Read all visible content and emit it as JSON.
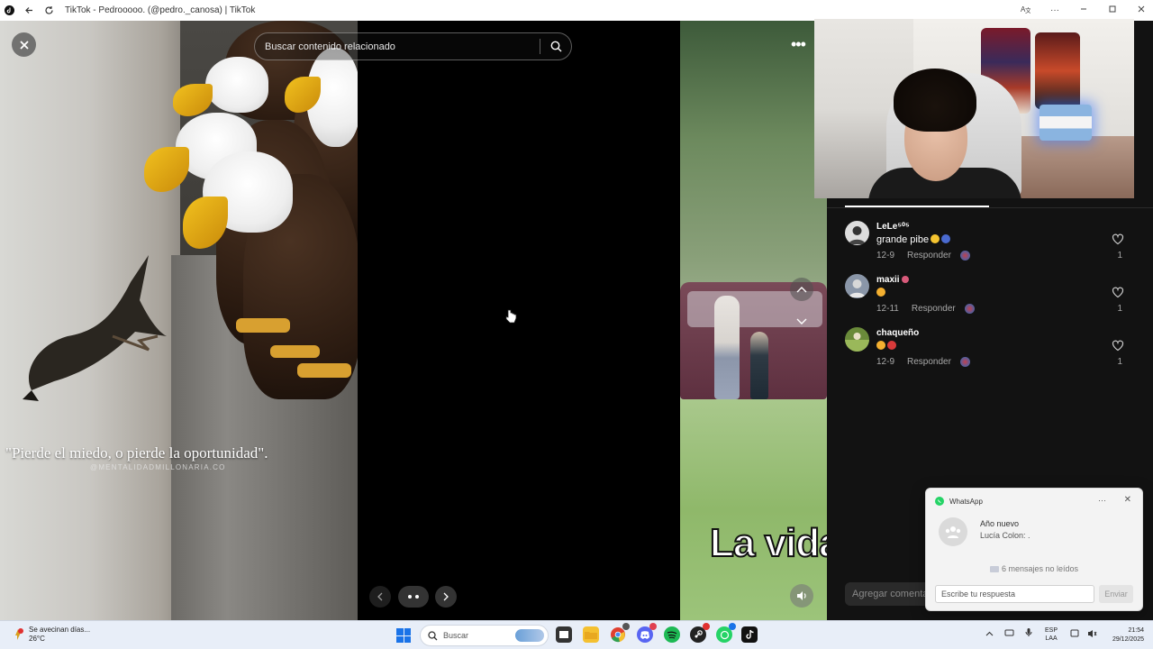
{
  "window": {
    "title": "TikTok - Pedrooooo. (@pedro._canosa) | TikTok",
    "controls": [
      "minimize",
      "maximize",
      "close"
    ]
  },
  "viewer": {
    "search_placeholder": "Buscar contenido relacionado",
    "left_slide": {
      "caption": "\"Pierde el miedo, o pierde la oportunidad\".",
      "watermark": "@MENTALIDADMILLONARIA.CO"
    },
    "right_slide": {
      "overlay_text": "La vida"
    }
  },
  "comments": [
    {
      "user": "LeLe⁵⁰⁵",
      "text": "grande pibe",
      "date": "12-9",
      "reply": "Responder",
      "likes": "1"
    },
    {
      "user": "maxii",
      "text": "",
      "date": "12-11",
      "reply": "Responder",
      "likes": "1"
    },
    {
      "user": "chaqueño",
      "text": "",
      "date": "12-9",
      "reply": "Responder",
      "likes": "1"
    }
  ],
  "comment_input_placeholder": "Agregar comentario...",
  "whatsapp_toast": {
    "app": "WhatsApp",
    "title": "Año nuevo",
    "message": "Lucía Colon: .",
    "unread": "6 mensajes no leídos",
    "reply_placeholder": "Escribe tu respuesta",
    "send": "Enviar"
  },
  "taskbar": {
    "weather_text": "Se avecinan días...",
    "weather_temp": "26°C",
    "search_label": "Buscar",
    "lang_line1": "ESP",
    "lang_line2": "LAA",
    "time": "21:54",
    "date": "29/12/2025"
  },
  "colors": {
    "tiktok_dark": "#121212",
    "whatsapp_green": "#25d366",
    "windows_blue": "#1a73e8"
  }
}
